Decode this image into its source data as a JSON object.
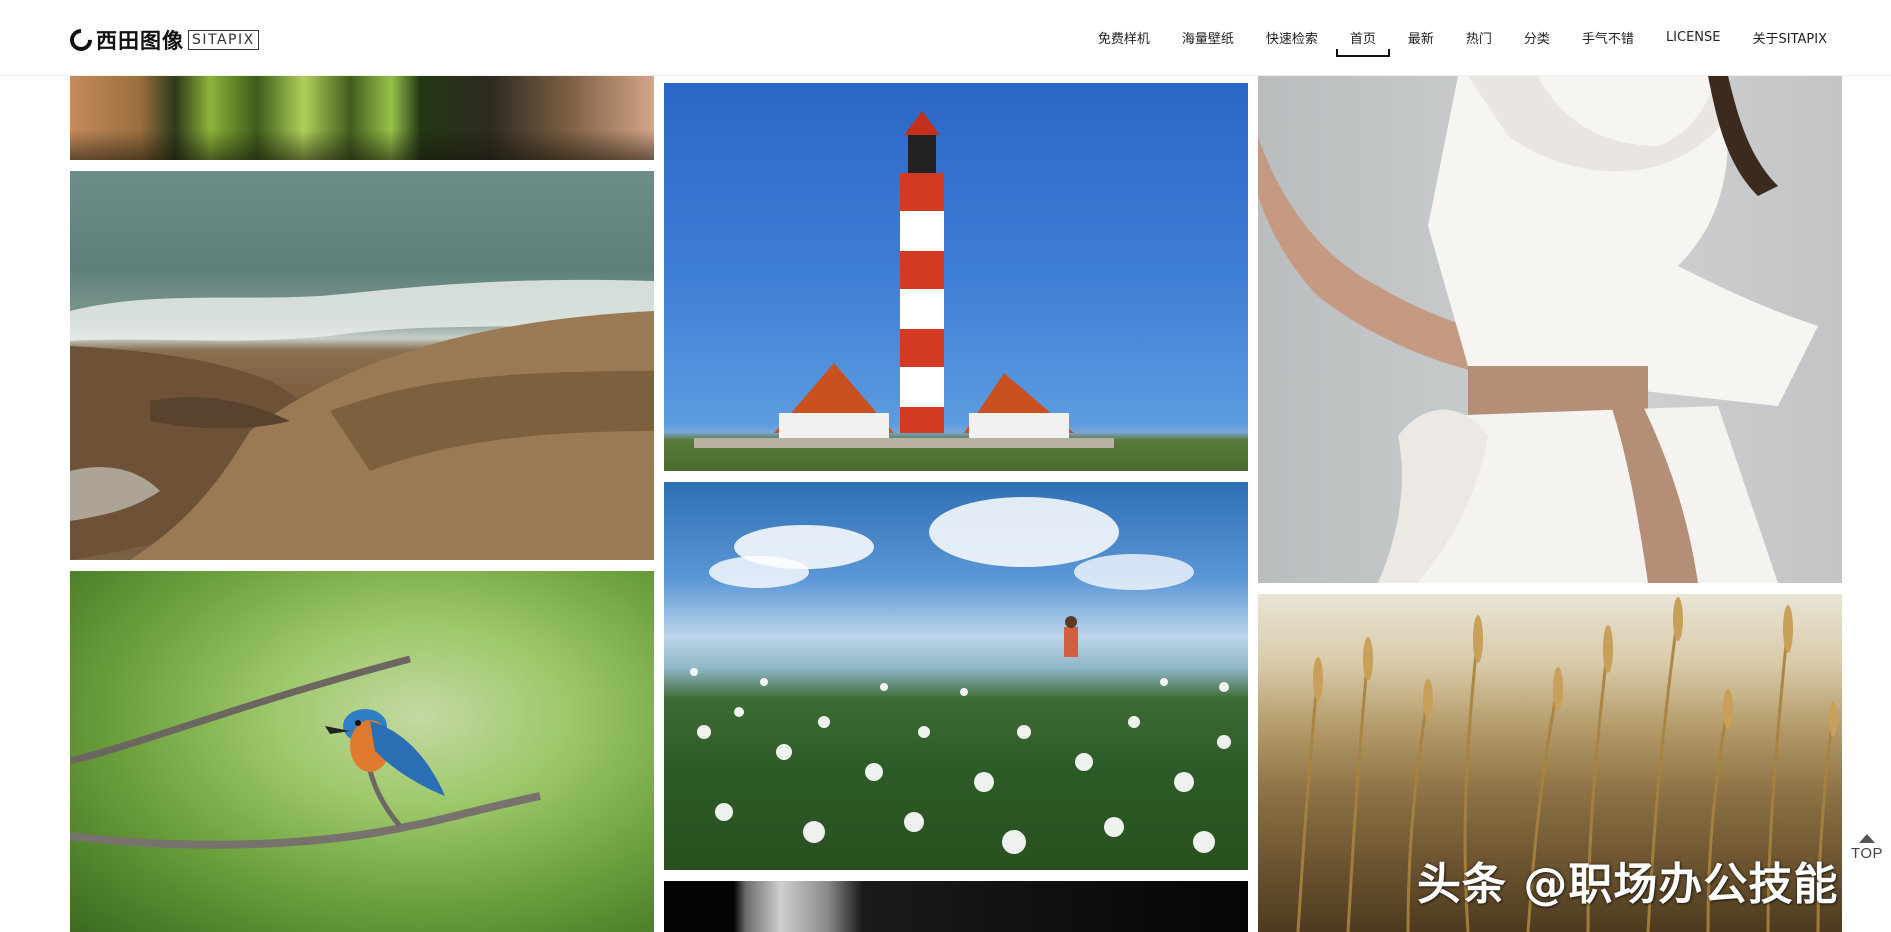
{
  "brand": {
    "name_cn": "西田图像",
    "name_en": "SITAPIX"
  },
  "nav": {
    "items": [
      {
        "label": "免费样机"
      },
      {
        "label": "海量壁纸"
      },
      {
        "label": "快速检索"
      },
      {
        "label": "首页",
        "active": true
      },
      {
        "label": "最新"
      },
      {
        "label": "热门"
      },
      {
        "label": "分类"
      },
      {
        "label": "手气不错"
      },
      {
        "label": "LICENSE"
      },
      {
        "label": "关于SITAPIX"
      }
    ]
  },
  "gallery": {
    "tiles": [
      {
        "name": "grass-close-up-photo"
      },
      {
        "name": "rocky-seashore-photo"
      },
      {
        "name": "kingfisher-bird-photo"
      },
      {
        "name": "red-white-lighthouse-photo"
      },
      {
        "name": "white-flower-field-photo"
      },
      {
        "name": "black-white-portrait-photo"
      },
      {
        "name": "woman-white-dress-photo"
      },
      {
        "name": "golden-wheat-grass-photo"
      }
    ]
  },
  "watermark": {
    "text": "头条 @职场办公技能"
  },
  "back_to_top": {
    "label": "TOP",
    "icon": "arrow-up-icon"
  },
  "colors": {
    "text": "#222222",
    "background": "#ffffff",
    "sky_blue": "#3e7fd6",
    "lighthouse_red": "#d23a22"
  }
}
